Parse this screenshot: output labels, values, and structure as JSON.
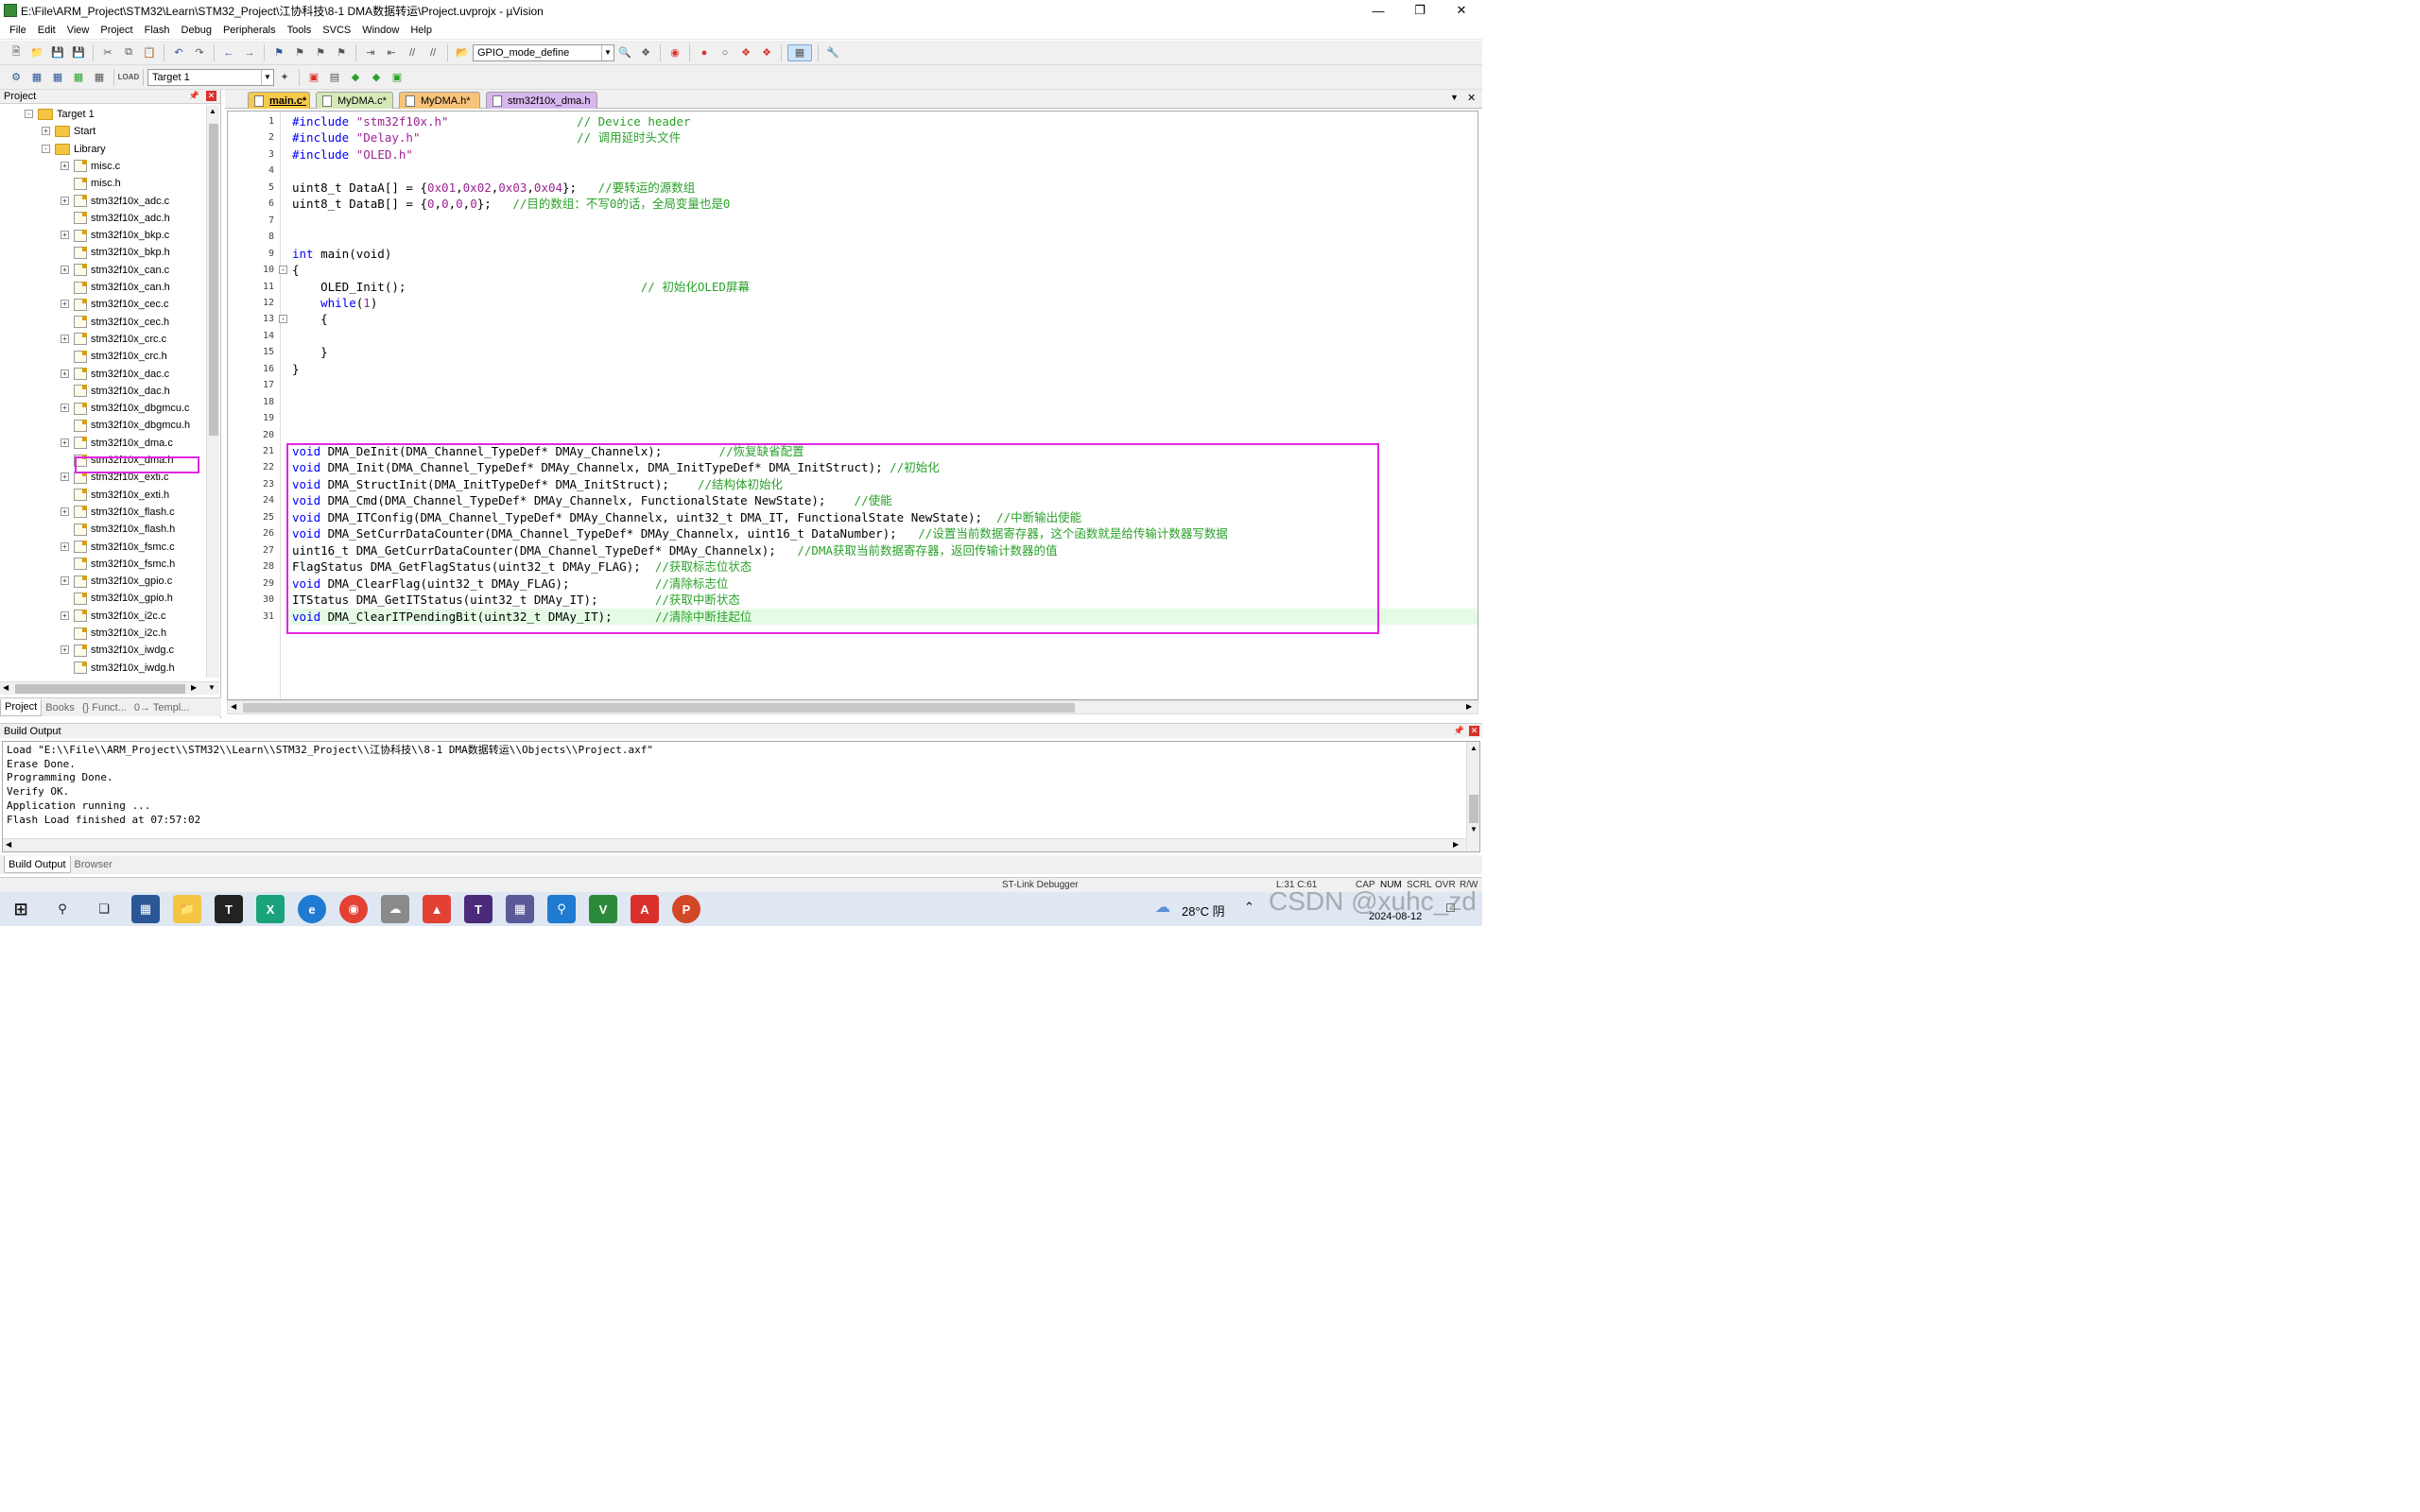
{
  "window": {
    "title": "E:\\File\\ARM_Project\\STM32\\Learn\\STM32_Project\\江协科技\\8-1 DMA数据转运\\Project.uvprojx - µVision"
  },
  "menu": [
    "File",
    "Edit",
    "View",
    "Project",
    "Flash",
    "Debug",
    "Peripherals",
    "Tools",
    "SVCS",
    "Window",
    "Help"
  ],
  "toolbar": {
    "find_combo": "GPIO_mode_define",
    "target_combo": "Target 1"
  },
  "project": {
    "header": "Project",
    "root": "Target 1",
    "groups": [
      "Start",
      "Library"
    ],
    "files": [
      "misc.c",
      "misc.h",
      "stm32f10x_adc.c",
      "stm32f10x_adc.h",
      "stm32f10x_bkp.c",
      "stm32f10x_bkp.h",
      "stm32f10x_can.c",
      "stm32f10x_can.h",
      "stm32f10x_cec.c",
      "stm32f10x_cec.h",
      "stm32f10x_crc.c",
      "stm32f10x_crc.h",
      "stm32f10x_dac.c",
      "stm32f10x_dac.h",
      "stm32f10x_dbgmcu.c",
      "stm32f10x_dbgmcu.h",
      "stm32f10x_dma.c",
      "stm32f10x_dma.h",
      "stm32f10x_exti.c",
      "stm32f10x_exti.h",
      "stm32f10x_flash.c",
      "stm32f10x_flash.h",
      "stm32f10x_fsmc.c",
      "stm32f10x_fsmc.h",
      "stm32f10x_gpio.c",
      "stm32f10x_gpio.h",
      "stm32f10x_i2c.c",
      "stm32f10x_i2c.h",
      "stm32f10x_iwdg.c",
      "stm32f10x_iwdg.h"
    ],
    "tabs": [
      "Project",
      "Books",
      "{} Funct...",
      "0→ Templ..."
    ]
  },
  "editor": {
    "tabs": [
      {
        "label": "main.c*",
        "color": "#f7c948"
      },
      {
        "label": "MyDMA.c*",
        "color": "#d6e9b8"
      },
      {
        "label": "MyDMA.h*",
        "color": "#f7c37a"
      },
      {
        "label": "stm32f10x_dma.h",
        "color": "#d7b7ee"
      }
    ],
    "lines": [
      {
        "n": "1",
        "t": "#include \"stm32f10x.h\"                  // Device header"
      },
      {
        "n": "2",
        "t": "#include \"Delay.h\"                      // 调用延时头文件"
      },
      {
        "n": "3",
        "t": "#include \"OLED.h\""
      },
      {
        "n": "4",
        "t": ""
      },
      {
        "n": "5",
        "t": "uint8_t DataA[] = {0x01,0x02,0x03,0x04};   //要转运的源数组"
      },
      {
        "n": "6",
        "t": "uint8_t DataB[] = {0,0,0,0};   //目的数组：不写0的话，全局变量也是0"
      },
      {
        "n": "7",
        "t": ""
      },
      {
        "n": "8",
        "t": ""
      },
      {
        "n": "9",
        "t": "int main(void)"
      },
      {
        "n": "10",
        "t": "{"
      },
      {
        "n": "11",
        "t": "    OLED_Init();                                 // 初始化OLED屏幕"
      },
      {
        "n": "12",
        "t": "    while(1)"
      },
      {
        "n": "13",
        "t": "    {"
      },
      {
        "n": "14",
        "t": ""
      },
      {
        "n": "15",
        "t": "    }"
      },
      {
        "n": "16",
        "t": "}"
      },
      {
        "n": "17",
        "t": ""
      },
      {
        "n": "18",
        "t": ""
      },
      {
        "n": "19",
        "t": ""
      },
      {
        "n": "20",
        "t": ""
      },
      {
        "n": "21",
        "t": "void DMA_DeInit(DMA_Channel_TypeDef* DMAy_Channelx);        //恢复缺省配置"
      },
      {
        "n": "22",
        "t": "void DMA_Init(DMA_Channel_TypeDef* DMAy_Channelx, DMA_InitTypeDef* DMA_InitStruct); //初始化"
      },
      {
        "n": "23",
        "t": "void DMA_StructInit(DMA_InitTypeDef* DMA_InitStruct);    //结构体初始化"
      },
      {
        "n": "24",
        "t": "void DMA_Cmd(DMA_Channel_TypeDef* DMAy_Channelx, FunctionalState NewState);    //使能"
      },
      {
        "n": "25",
        "t": "void DMA_ITConfig(DMA_Channel_TypeDef* DMAy_Channelx, uint32_t DMA_IT, FunctionalState NewState);  //中断输出使能"
      },
      {
        "n": "26",
        "t": "void DMA_SetCurrDataCounter(DMA_Channel_TypeDef* DMAy_Channelx, uint16_t DataNumber);   //设置当前数据寄存器，这个函数就是给传输计数器写数据"
      },
      {
        "n": "27",
        "t": "uint16_t DMA_GetCurrDataCounter(DMA_Channel_TypeDef* DMAy_Channelx);   //DMA获取当前数据寄存器，返回传输计数器的值"
      },
      {
        "n": "28",
        "t": "FlagStatus DMA_GetFlagStatus(uint32_t DMAy_FLAG);  //获取标志位状态"
      },
      {
        "n": "29",
        "t": "void DMA_ClearFlag(uint32_t DMAy_FLAG);            //清除标志位"
      },
      {
        "n": "30",
        "t": "ITStatus DMA_GetITStatus(uint32_t DMAy_IT);        //获取中断状态"
      },
      {
        "n": "31",
        "t": "void DMA_ClearITPendingBit(uint32_t DMAy_IT);      //清除中断挂起位"
      }
    ]
  },
  "build": {
    "header": "Build Output",
    "lines": [
      "Load \"E:\\\\File\\\\ARM_Project\\\\STM32\\\\Learn\\\\STM32_Project\\\\江协科技\\\\8-1 DMA数据转运\\\\Objects\\\\Project.axf\"",
      "Erase Done.",
      "Programming Done.",
      "Verify OK.",
      "Application running ...",
      "Flash Load finished at 07:57:02"
    ],
    "tabs": [
      "Build Output",
      "Browser"
    ]
  },
  "status": {
    "debugger": "ST-Link Debugger",
    "position": "L:31 C:61",
    "flags": [
      "CAP",
      "NUM",
      "SCRL",
      "OVR",
      "R/W"
    ]
  },
  "taskbar": {
    "weather": "28°C 阴",
    "date": "2024-08-12",
    "watermark": "CSDN @xuhc_zd"
  }
}
